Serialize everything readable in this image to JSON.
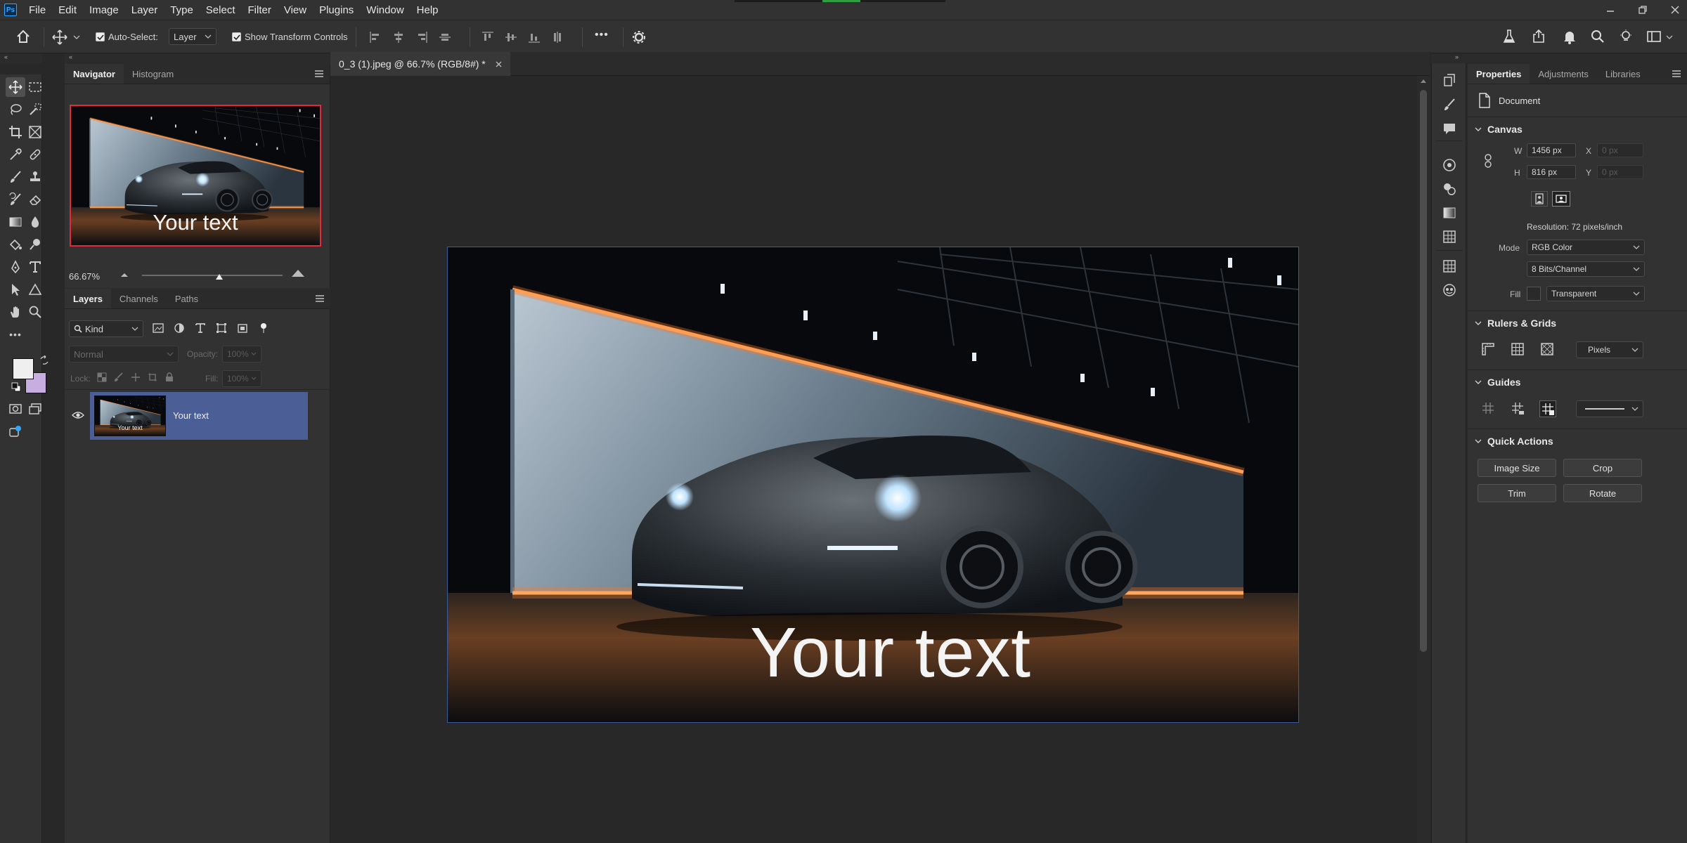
{
  "menubar": {
    "logo": "Ps",
    "items": [
      "File",
      "Edit",
      "Image",
      "Layer",
      "Type",
      "Select",
      "Filter",
      "View",
      "Plugins",
      "Window",
      "Help"
    ]
  },
  "optionsbar": {
    "auto_select_label": "Auto-Select:",
    "auto_select_checked": true,
    "auto_select_target": "Layer",
    "show_transform_label": "Show Transform Controls",
    "show_transform_checked": true,
    "more": "•••"
  },
  "navigator": {
    "tabs": [
      "Navigator",
      "Histogram"
    ],
    "active_tab": "Navigator",
    "zoom": "66.67%",
    "zoom_fraction": 0.55,
    "preview_text": "Your text"
  },
  "layers": {
    "tabs": [
      "Layers",
      "Channels",
      "Paths"
    ],
    "filter_label": "Kind",
    "blend_mode": "Normal",
    "opacity_label": "Opacity:",
    "opacity_value": "100%",
    "lock_label": "Lock:",
    "fill_label": "Fill:",
    "fill_value": "100%",
    "items": [
      {
        "name": "Your text",
        "thumb_text": "Your text",
        "visible": true,
        "selected": true
      }
    ]
  },
  "document": {
    "tab_title": "0_3 (1).jpeg @ 66.7% (RGB/8#) *",
    "canvas_text": "Your text"
  },
  "properties": {
    "tabs": [
      "Properties",
      "Adjustments",
      "Libraries"
    ],
    "active_tab": "Properties",
    "kind": "Document",
    "canvas": {
      "title": "Canvas",
      "w_label": "W",
      "w_value": "1456 px",
      "h_label": "H",
      "h_value": "816 px",
      "x_label": "X",
      "x_value": "0 px",
      "y_label": "Y",
      "y_value": "0 px",
      "resolution": "Resolution: 72 pixels/inch",
      "mode_label": "Mode",
      "mode_value": "RGB Color",
      "depth_value": "8 Bits/Channel",
      "fill_label": "Fill",
      "fill_value": "Transparent"
    },
    "rulers": {
      "title": "Rulers & Grids",
      "units": "Pixels"
    },
    "guides": {
      "title": "Guides"
    },
    "quick_actions": {
      "title": "Quick Actions",
      "buttons": [
        "Image Size",
        "Crop",
        "Trim",
        "Rotate"
      ]
    }
  },
  "colors": {
    "accent": "#31a8ff",
    "selected_layer": "#4b5e96",
    "foreground_swatch": "#efefef",
    "background_swatch": "#c8aee0",
    "navigator_frame": "#e8283a",
    "canvas_border": "#3c5a9c"
  }
}
